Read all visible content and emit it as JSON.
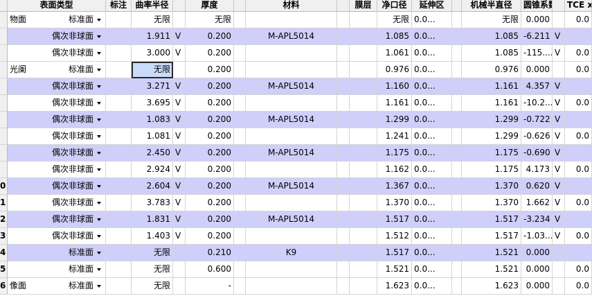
{
  "columns": [
    {
      "key": "type",
      "label": "表面类型"
    },
    {
      "key": "tag",
      "label": "标注"
    },
    {
      "key": "radius",
      "label": "曲率半径"
    },
    {
      "key": "flag1",
      "label": ""
    },
    {
      "key": "thick",
      "label": "厚度"
    },
    {
      "key": "flag2",
      "label": ""
    },
    {
      "key": "material",
      "label": "材料"
    },
    {
      "key": "flag3",
      "label": ""
    },
    {
      "key": "coating",
      "label": "膜层"
    },
    {
      "key": "clear",
      "label": "净口径"
    },
    {
      "key": "ext",
      "label": "延伸区"
    },
    {
      "key": "flag4",
      "label": ""
    },
    {
      "key": "mech",
      "label": "机械半直径"
    },
    {
      "key": "conic",
      "label": "圆锥系数"
    },
    {
      "key": "flag5",
      "label": ""
    },
    {
      "key": "tce",
      "label": "TCE x"
    }
  ],
  "rows": [
    {
      "num": "",
      "label": "物面",
      "type": "标准面",
      "radius": "无限",
      "rflag": "",
      "thick": "无限",
      "material": "",
      "clear": "无限",
      "ext": "0.0...",
      "mech": "无限",
      "conic": "0.000",
      "cflag": "",
      "tce": "0.0"
    },
    {
      "num": "",
      "label": "",
      "type": "偶次非球面",
      "radius": "1.911",
      "rflag": "V",
      "thick": "0.200",
      "material": "M-APL5014",
      "clear": "1.085",
      "ext": "0.0...",
      "mech": "1.085",
      "conic": "-6.211",
      "cflag": "V",
      "tce": ""
    },
    {
      "num": "",
      "label": "",
      "type": "偶次非球面",
      "radius": "3.000",
      "rflag": "V",
      "thick": "0.200",
      "material": "",
      "clear": "1.061",
      "ext": "0.0...",
      "mech": "1.085",
      "conic": "-115....",
      "cflag": "V",
      "tce": "0.0"
    },
    {
      "num": "",
      "label": "光阑",
      "type": "标准面",
      "radius": "无限",
      "rflag": "",
      "thick": "0.200",
      "material": "",
      "clear": "0.976",
      "ext": "0.0...",
      "mech": "0.976",
      "conic": "0.000",
      "cflag": "",
      "tce": "0.0"
    },
    {
      "num": "",
      "label": "",
      "type": "偶次非球面",
      "radius": "3.271",
      "rflag": "V",
      "thick": "0.200",
      "material": "M-APL5014",
      "clear": "1.160",
      "ext": "0.0...",
      "mech": "1.161",
      "conic": "4.357",
      "cflag": "V",
      "tce": ""
    },
    {
      "num": "",
      "label": "",
      "type": "偶次非球面",
      "radius": "3.695",
      "rflag": "V",
      "thick": "0.200",
      "material": "",
      "clear": "1.161",
      "ext": "0.0...",
      "mech": "1.161",
      "conic": "-10.2...",
      "cflag": "V",
      "tce": "0.0"
    },
    {
      "num": "",
      "label": "",
      "type": "偶次非球面",
      "radius": "1.083",
      "rflag": "V",
      "thick": "0.200",
      "material": "M-APL5014",
      "clear": "1.299",
      "ext": "0.0...",
      "mech": "1.299",
      "conic": "-0.722",
      "cflag": "V",
      "tce": ""
    },
    {
      "num": "",
      "label": "",
      "type": "偶次非球面",
      "radius": "1.081",
      "rflag": "V",
      "thick": "0.200",
      "material": "",
      "clear": "1.241",
      "ext": "0.0...",
      "mech": "1.299",
      "conic": "-0.626",
      "cflag": "V",
      "tce": "0.0"
    },
    {
      "num": "",
      "label": "",
      "type": "偶次非球面",
      "radius": "2.450",
      "rflag": "V",
      "thick": "0.200",
      "material": "M-APL5014",
      "clear": "1.175",
      "ext": "0.0...",
      "mech": "1.175",
      "conic": "-0.690",
      "cflag": "V",
      "tce": ""
    },
    {
      "num": "",
      "label": "",
      "type": "偶次非球面",
      "radius": "2.924",
      "rflag": "V",
      "thick": "0.200",
      "material": "",
      "clear": "1.162",
      "ext": "0.0...",
      "mech": "1.175",
      "conic": "4.173",
      "cflag": "V",
      "tce": "0.0"
    },
    {
      "num": "0",
      "label": "",
      "type": "偶次非球面",
      "radius": "2.604",
      "rflag": "V",
      "thick": "0.200",
      "material": "M-APL5014",
      "clear": "1.367",
      "ext": "0.0...",
      "mech": "1.370",
      "conic": "0.620",
      "cflag": "V",
      "tce": ""
    },
    {
      "num": "1",
      "label": "",
      "type": "偶次非球面",
      "radius": "3.783",
      "rflag": "V",
      "thick": "0.200",
      "material": "",
      "clear": "1.370",
      "ext": "0.0...",
      "mech": "1.370",
      "conic": "1.662",
      "cflag": "V",
      "tce": "0.0"
    },
    {
      "num": "2",
      "label": "",
      "type": "偶次非球面",
      "radius": "1.831",
      "rflag": "V",
      "thick": "0.200",
      "material": "M-APL5014",
      "clear": "1.517",
      "ext": "0.0...",
      "mech": "1.517",
      "conic": "-3.234",
      "cflag": "V",
      "tce": ""
    },
    {
      "num": "3",
      "label": "",
      "type": "偶次非球面",
      "radius": "1.403",
      "rflag": "V",
      "thick": "0.200",
      "material": "",
      "clear": "1.512",
      "ext": "0.0...",
      "mech": "1.517",
      "conic": "-1.03...",
      "cflag": "V",
      "tce": "0.0"
    },
    {
      "num": "4",
      "label": "",
      "type": "标准面",
      "radius": "无限",
      "rflag": "",
      "thick": "0.210",
      "material": "K9",
      "clear": "1.517",
      "ext": "0.0...",
      "mech": "1.521",
      "conic": "0.000",
      "cflag": "",
      "tce": ""
    },
    {
      "num": "5",
      "label": "",
      "type": "标准面",
      "radius": "无限",
      "rflag": "",
      "thick": "0.600",
      "material": "",
      "clear": "1.521",
      "ext": "0.0...",
      "mech": "1.521",
      "conic": "0.000",
      "cflag": "",
      "tce": "0.0"
    },
    {
      "num": "6",
      "label": "像面",
      "type": "标准面",
      "radius": "无限",
      "rflag": "",
      "thick": "-",
      "material": "",
      "clear": "1.623",
      "ext": "0.0...",
      "mech": "1.623",
      "conic": "0.000",
      "cflag": "",
      "tce": "0.0"
    }
  ],
  "selected": {
    "row": 3,
    "col": "radius"
  },
  "colors": {
    "alt_row": "#cfcffa",
    "header_bg": "#f0f0f0",
    "grid": "#d4d4d4",
    "selected": "#c8dcfa"
  }
}
